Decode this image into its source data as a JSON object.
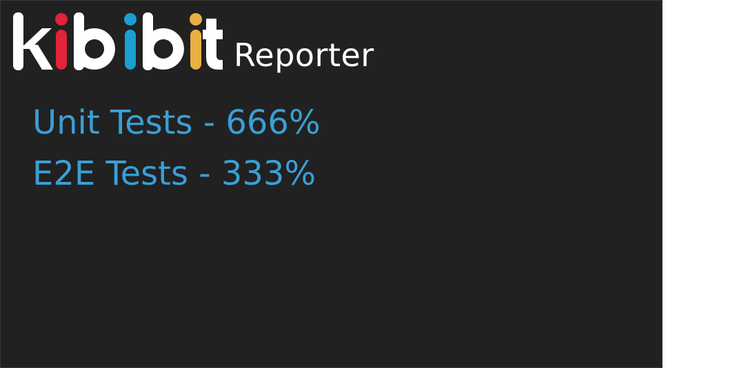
{
  "brand": {
    "logo_text": "kibibit",
    "product": "Reporter",
    "colors": {
      "i_first": "#e0243a",
      "b_second": "#1a9fd0",
      "i_third": "#e9b042",
      "text": "#ffffff"
    }
  },
  "stats": [
    {
      "label": "Unit Tests - 666%"
    },
    {
      "label": "E2E Tests - 333%"
    }
  ],
  "colors": {
    "panel_bg": "#212121",
    "stat_text": "#3a9fd6"
  }
}
